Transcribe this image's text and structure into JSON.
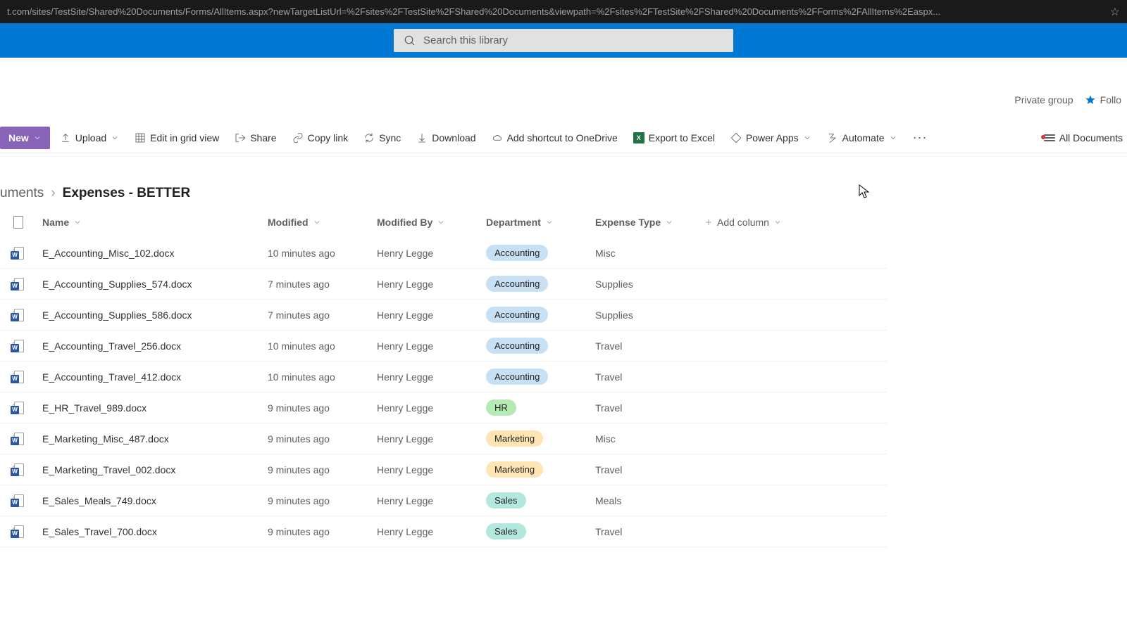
{
  "browser": {
    "url": "t.com/sites/TestSite/Shared%20Documents/Forms/AllItems.aspx?newTargetListUrl=%2Fsites%2FTestSite%2FShared%20Documents&viewpath=%2Fsites%2FTestSite%2FShared%20Documents%2FForms%2FAllItems%2Easpx..."
  },
  "search": {
    "placeholder": "Search this library"
  },
  "site": {
    "group": "Private group",
    "follow": "Follo"
  },
  "commands": {
    "new": "New",
    "upload": "Upload",
    "edit_grid": "Edit in grid view",
    "share": "Share",
    "copy_link": "Copy link",
    "sync": "Sync",
    "download": "Download",
    "add_shortcut": "Add shortcut to OneDrive",
    "export_excel": "Export to Excel",
    "power_apps": "Power Apps",
    "automate": "Automate",
    "view_switch": "All Documents"
  },
  "breadcrumb": {
    "prev": "uments",
    "current": "Expenses - BETTER"
  },
  "columns": {
    "name": "Name",
    "modified": "Modified",
    "modified_by": "Modified By",
    "department": "Department",
    "expense_type": "Expense Type",
    "add": "Add column"
  },
  "rows": [
    {
      "name": "E_Accounting_Misc_102.docx",
      "modified": "10 minutes ago",
      "by": "Henry Legge",
      "dept": "Accounting",
      "etype": "Misc"
    },
    {
      "name": "E_Accounting_Supplies_574.docx",
      "modified": "7 minutes ago",
      "by": "Henry Legge",
      "dept": "Accounting",
      "etype": "Supplies"
    },
    {
      "name": "E_Accounting_Supplies_586.docx",
      "modified": "7 minutes ago",
      "by": "Henry Legge",
      "dept": "Accounting",
      "etype": "Supplies"
    },
    {
      "name": "E_Accounting_Travel_256.docx",
      "modified": "10 minutes ago",
      "by": "Henry Legge",
      "dept": "Accounting",
      "etype": "Travel"
    },
    {
      "name": "E_Accounting_Travel_412.docx",
      "modified": "10 minutes ago",
      "by": "Henry Legge",
      "dept": "Accounting",
      "etype": "Travel"
    },
    {
      "name": "E_HR_Travel_989.docx",
      "modified": "9 minutes ago",
      "by": "Henry Legge",
      "dept": "HR",
      "etype": "Travel"
    },
    {
      "name": "E_Marketing_Misc_487.docx",
      "modified": "9 minutes ago",
      "by": "Henry Legge",
      "dept": "Marketing",
      "etype": "Misc"
    },
    {
      "name": "E_Marketing_Travel_002.docx",
      "modified": "9 minutes ago",
      "by": "Henry Legge",
      "dept": "Marketing",
      "etype": "Travel"
    },
    {
      "name": "E_Sales_Meals_749.docx",
      "modified": "9 minutes ago",
      "by": "Henry Legge",
      "dept": "Sales",
      "etype": "Meals"
    },
    {
      "name": "E_Sales_Travel_700.docx",
      "modified": "9 minutes ago",
      "by": "Henry Legge",
      "dept": "Sales",
      "etype": "Travel"
    }
  ]
}
